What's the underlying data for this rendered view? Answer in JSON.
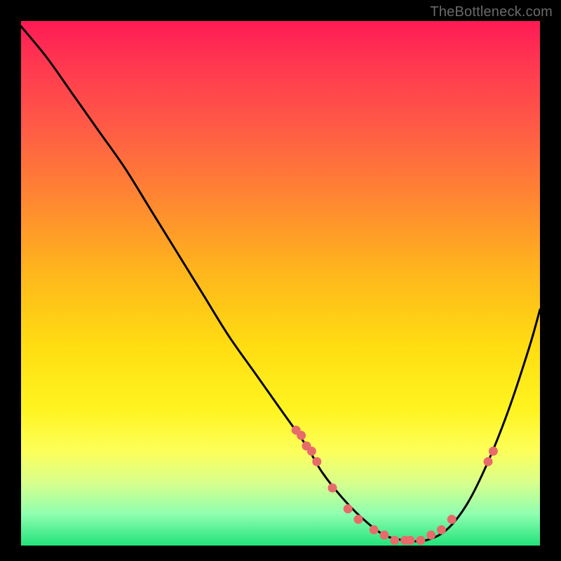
{
  "watermark": "TheBottleneck.com",
  "chart_data": {
    "type": "line",
    "title": "",
    "xlabel": "",
    "ylabel": "",
    "xlim": [
      0,
      100
    ],
    "ylim": [
      0,
      100
    ],
    "grid": false,
    "series": [
      {
        "name": "curve",
        "color": "#000000",
        "x": [
          0,
          5,
          10,
          15,
          20,
          25,
          30,
          35,
          40,
          45,
          50,
          55,
          58,
          62,
          66,
          70,
          74,
          78,
          82,
          86,
          90,
          94,
          98,
          100
        ],
        "y": [
          99,
          93,
          86,
          79,
          72,
          64,
          56,
          48,
          40,
          33,
          26,
          19,
          14,
          9,
          5,
          2,
          1,
          1,
          3,
          8,
          16,
          26,
          38,
          45
        ]
      }
    ],
    "markers": {
      "name": "dots",
      "color": "#e86b6b",
      "x": [
        53,
        54,
        55,
        56,
        57,
        60,
        63,
        65,
        68,
        70,
        72,
        74,
        75,
        77,
        79,
        81,
        83,
        90,
        91
      ],
      "y": [
        22,
        21,
        19,
        18,
        16,
        11,
        7,
        5,
        3,
        2,
        1,
        1,
        1,
        1,
        2,
        3,
        5,
        16,
        18
      ]
    },
    "gradient_stops": [
      {
        "pos": 0.0,
        "color": "#ff1a55"
      },
      {
        "pos": 0.2,
        "color": "#ff5a46"
      },
      {
        "pos": 0.48,
        "color": "#ffb61c"
      },
      {
        "pos": 0.74,
        "color": "#fff420"
      },
      {
        "pos": 0.94,
        "color": "#8fffb0"
      },
      {
        "pos": 1.0,
        "color": "#22e37a"
      }
    ]
  }
}
